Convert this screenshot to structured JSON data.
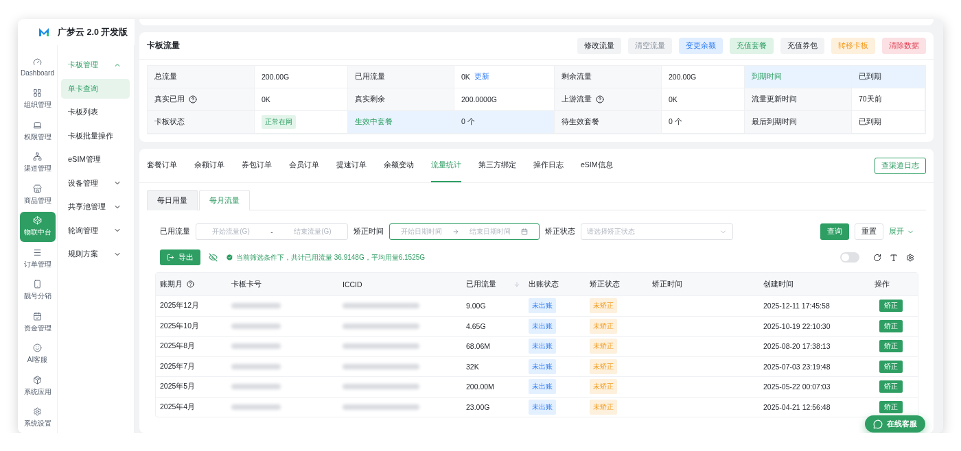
{
  "app": {
    "title": "广梦云 2.0 开发版"
  },
  "nav": [
    {
      "label": "Dashboard",
      "selected": false
    },
    {
      "label": "组织管理",
      "selected": false
    },
    {
      "label": "权限管理",
      "selected": false
    },
    {
      "label": "渠道管理",
      "selected": false
    },
    {
      "label": "商品管理",
      "selected": false
    },
    {
      "label": "物联中台",
      "selected": true
    },
    {
      "label": "订单管理",
      "selected": false
    },
    {
      "label": "靓号分销",
      "selected": false
    },
    {
      "label": "资金管理",
      "selected": false
    },
    {
      "label": "AI客服",
      "selected": false
    },
    {
      "label": "系统应用",
      "selected": false
    },
    {
      "label": "系统设置",
      "selected": false
    }
  ],
  "subnav": [
    {
      "label": "卡板管理",
      "kind": "group",
      "expanded": true,
      "active": true
    },
    {
      "label": "单卡查询",
      "kind": "item",
      "selected": true
    },
    {
      "label": "卡板列表",
      "kind": "item",
      "selected": false
    },
    {
      "label": "卡板批量操作",
      "kind": "item",
      "selected": false
    },
    {
      "label": "eSIM管理",
      "kind": "item",
      "selected": false
    },
    {
      "label": "设备管理",
      "kind": "group",
      "expanded": false,
      "active": false
    },
    {
      "label": "共享池管理",
      "kind": "group",
      "expanded": false,
      "active": false
    },
    {
      "label": "轮询管理",
      "kind": "group",
      "expanded": false,
      "active": false
    },
    {
      "label": "规则方案",
      "kind": "group",
      "expanded": false,
      "active": false
    }
  ],
  "card": {
    "title": "卡板流量",
    "buttons": [
      {
        "label": "修改流量",
        "kind": "default"
      },
      {
        "label": "清空流量",
        "kind": "muted"
      },
      {
        "label": "变更余额",
        "kind": "blue"
      },
      {
        "label": "充值套餐",
        "kind": "green"
      },
      {
        "label": "充值券包",
        "kind": "default"
      },
      {
        "label": "转移卡板",
        "kind": "orange"
      },
      {
        "label": "清除数据",
        "kind": "red"
      }
    ],
    "info_rows": [
      [
        {
          "kind": "label",
          "text": "总流量",
          "highlighted": false
        },
        {
          "kind": "value",
          "text": "200.00G",
          "highlighted": false
        },
        {
          "kind": "label",
          "text": "已用流量",
          "highlighted": false
        },
        {
          "kind": "value",
          "text": "0K",
          "link": "更新",
          "highlighted": false
        },
        {
          "kind": "label",
          "text": "剩余流量",
          "highlighted": false
        },
        {
          "kind": "value",
          "text": "200.00G",
          "highlighted": false
        },
        {
          "kind": "label",
          "text": "到期时间",
          "highlighted": true
        },
        {
          "kind": "value",
          "text": "已到期",
          "highlighted": true
        }
      ],
      [
        {
          "kind": "label",
          "text": "真实已用",
          "help": true,
          "highlighted": false
        },
        {
          "kind": "value",
          "text": "0K",
          "highlighted": false
        },
        {
          "kind": "label",
          "text": "真实剩余",
          "highlighted": false
        },
        {
          "kind": "value",
          "text": "200.0000G",
          "highlighted": false
        },
        {
          "kind": "label",
          "text": "上游流量",
          "help": true,
          "highlighted": false
        },
        {
          "kind": "value",
          "text": "0K",
          "highlighted": false
        },
        {
          "kind": "label",
          "text": "流量更新时间",
          "highlighted": false
        },
        {
          "kind": "value",
          "text": "70天前",
          "highlighted": false
        }
      ],
      [
        {
          "kind": "label",
          "text": "卡板状态",
          "highlighted": false
        },
        {
          "kind": "tag",
          "text": "正常在网",
          "highlighted": false
        },
        {
          "kind": "label",
          "text": "生效中套餐",
          "highlighted": true
        },
        {
          "kind": "value",
          "text": "0 个",
          "highlighted": true
        },
        {
          "kind": "label",
          "text": "待生效套餐",
          "highlighted": false
        },
        {
          "kind": "value",
          "text": "0 个",
          "highlighted": false
        },
        {
          "kind": "label",
          "text": "最后到期时间",
          "highlighted": false
        },
        {
          "kind": "value",
          "text": "已到期",
          "highlighted": false
        }
      ]
    ]
  },
  "tabs": [
    {
      "label": "套餐订单",
      "selected": false
    },
    {
      "label": "余额订单",
      "selected": false
    },
    {
      "label": "券包订单",
      "selected": false
    },
    {
      "label": "会员订单",
      "selected": false
    },
    {
      "label": "提速订单",
      "selected": false
    },
    {
      "label": "余额变动",
      "selected": false
    },
    {
      "label": "流量统计",
      "selected": true
    },
    {
      "label": "第三方绑定",
      "selected": false
    },
    {
      "label": "操作日志",
      "selected": false
    },
    {
      "label": "eSIM信息",
      "selected": false
    }
  ],
  "log_button": "查渠道日志",
  "subtabs": [
    {
      "label": "每日用量",
      "selected": false
    },
    {
      "label": "每月流量",
      "selected": true
    }
  ],
  "filters": [
    {
      "kind": "range",
      "label": "已用流量",
      "placeholder_from": "开始流量(G)",
      "separator": "-",
      "placeholder_to": "结束流量(G)",
      "focused": false
    },
    {
      "kind": "date_range",
      "label": "矫正时间",
      "placeholder_from": "开始日期时间",
      "placeholder_to": "结束日期时间",
      "focused": true
    },
    {
      "kind": "select",
      "label": "矫正状态",
      "placeholder": "请选择矫正状态",
      "focused": false
    }
  ],
  "query_button": "查询",
  "reset_button": "重置",
  "expand_link": "展开",
  "toolbar": {
    "export": "导出",
    "summary": "当前筛选条件下，共计已用流量 36.9148G，平均用量6.1525G",
    "switch_on": false
  },
  "table": {
    "columns": [
      {
        "label": "账期月",
        "help": true
      },
      {
        "label": "卡板卡号"
      },
      {
        "label": "ICCID"
      },
      {
        "label": "已用流量",
        "sortable": true
      },
      {
        "label": "出账状态"
      },
      {
        "label": "矫正状态"
      },
      {
        "label": "矫正时间"
      },
      {
        "label": "创建时间"
      },
      {
        "label": "操作"
      }
    ],
    "rows": [
      {
        "month": "2025年12月",
        "used": "9.00G",
        "billing": "未出账",
        "correction": "未矫正",
        "created": "2025-12-11 17:45:58",
        "action": "矫正"
      },
      {
        "month": "2025年10月",
        "used": "4.65G",
        "billing": "未出账",
        "correction": "未矫正",
        "created": "2025-10-19 22:10:30",
        "action": "矫正"
      },
      {
        "month": "2025年8月",
        "used": "68.06M",
        "billing": "未出账",
        "correction": "未矫正",
        "created": "2025-08-20 17:38:13",
        "action": "矫正"
      },
      {
        "month": "2025年7月",
        "used": "32K",
        "billing": "未出账",
        "correction": "未矫正",
        "created": "2025-07-03 23:19:48",
        "action": "矫正"
      },
      {
        "month": "2025年5月",
        "used": "200.00M",
        "billing": "未出账",
        "correction": "未矫正",
        "created": "2025-05-22 00:07:03",
        "action": "矫正"
      },
      {
        "month": "2025年4月",
        "used": "23.00G",
        "billing": "未出账",
        "correction": "未矫正",
        "created": "2025-04-21 12:56:48",
        "action": "矫正"
      }
    ]
  },
  "chat": {
    "label": "在线客服"
  }
}
